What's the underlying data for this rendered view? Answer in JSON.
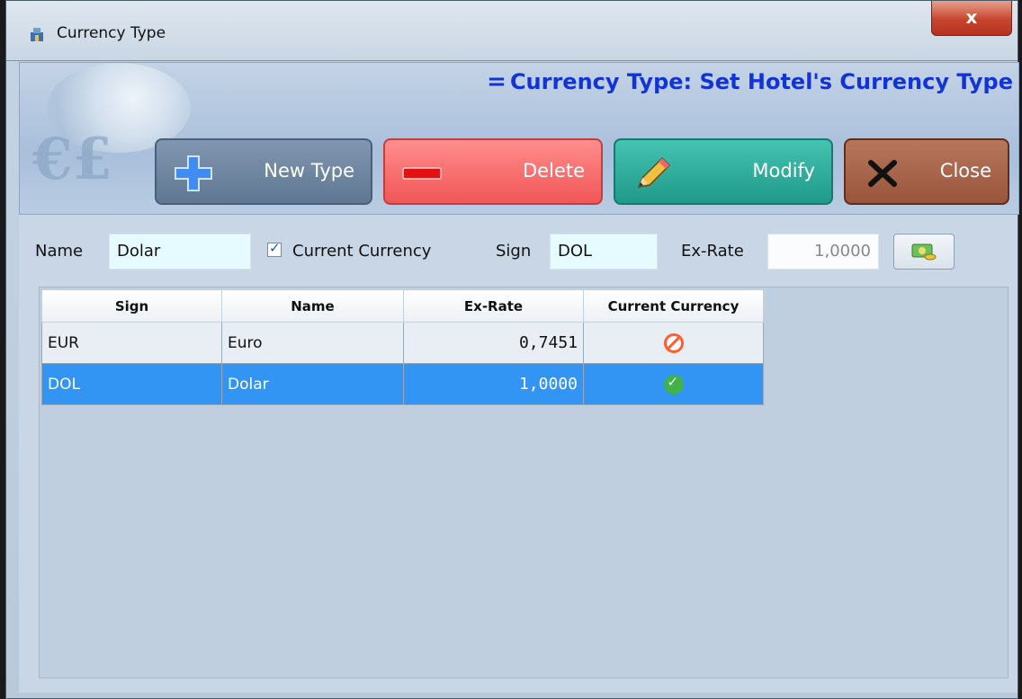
{
  "window": {
    "title": "Currency Type",
    "close_glyph": "x"
  },
  "header": {
    "title": "Currency Type: Set Hotel's Currency Type",
    "title_marker": "="
  },
  "toolbar": {
    "new_label": "New Type",
    "delete_label": "Delete",
    "modify_label": "Modify",
    "close_label": "Close"
  },
  "form": {
    "name_label": "Name",
    "name_value": "Dolar",
    "current_label": "Current Currency",
    "current_checked": true,
    "sign_label": "Sign",
    "sign_value": "DOL",
    "rate_label": "Ex-Rate",
    "rate_value": "1,0000"
  },
  "grid": {
    "columns": [
      "Sign",
      "Name",
      "Ex-Rate",
      "Current Currency"
    ],
    "rows": [
      {
        "sign": "EUR",
        "name": "Euro",
        "rate": "0,7451",
        "current": "no-icon",
        "selected": false
      },
      {
        "sign": "DOL",
        "name": "Dolar",
        "rate": "1,0000",
        "current": "check-icon",
        "selected": true
      }
    ]
  },
  "colors": {
    "header_title": "#1234d6",
    "selected_row": "#3395f3"
  }
}
